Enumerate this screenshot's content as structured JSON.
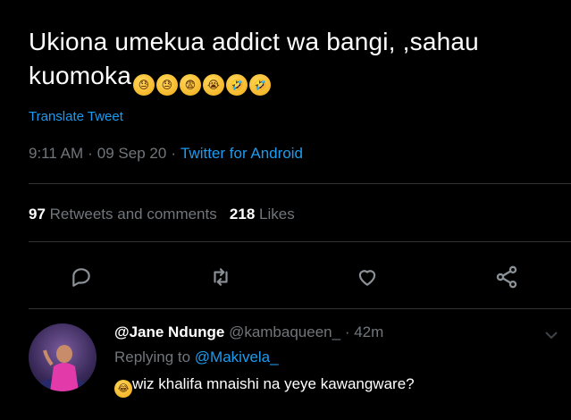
{
  "tweet": {
    "text_line1": "Ukiona umekua addict wa bangi, ,sahau",
    "text_line2": "kuomoka",
    "emojis": [
      "😓",
      "😓",
      "😨",
      "😭",
      "🤣",
      "🤣"
    ],
    "translate_label": "Translate Tweet",
    "time": "9:11 AM",
    "date": "09 Sep 20",
    "source": "Twitter for Android",
    "retweets_count": "97",
    "retweets_label": "Retweets and comments",
    "likes_count": "218",
    "likes_label": "Likes"
  },
  "actions": [
    "reply-icon",
    "retweet-icon",
    "like-icon",
    "share-icon"
  ],
  "reply": {
    "display_name": "@Jane Ndunge",
    "handle": "@kambaqueen_",
    "time_ago": "42m",
    "replying_prefix": "Replying to",
    "replying_to": "@Makivela_",
    "emoji": "😂",
    "text": "wiz khalifa mnaishi na yeye kawangware?"
  },
  "colors": {
    "background": "#000000",
    "text": "#ffffff",
    "muted": "#71767b",
    "link": "#1d9bf0",
    "divider": "#2f3336"
  }
}
